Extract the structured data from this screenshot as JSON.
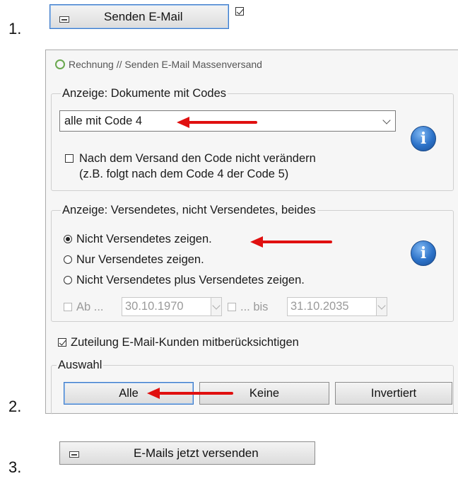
{
  "steps": {
    "one": "1.",
    "two": "2.",
    "three": "3."
  },
  "top_button": {
    "label": "Senden E-Mail",
    "icon": "envelope-icon"
  },
  "dialog": {
    "title": "Rechnung // Senden E-Mail Massenversand",
    "group_codes": {
      "legend": "Anzeige: Dokumente mit Codes",
      "combo_value": "alle mit Code 4",
      "checkbox_line1": "Nach dem Versand den Code nicht verändern",
      "checkbox_line2": "(z.B. folgt nach dem Code 4 der Code 5)"
    },
    "group_sent": {
      "legend": "Anzeige: Versendetes, nicht Versendetes, beides",
      "radio1": "Nicht Versendetes zeigen.",
      "radio2": "Nur Versendetes zeigen.",
      "radio3": "Nicht Versendetes plus Versendetes zeigen.",
      "from_label": "Ab ...",
      "from_date": "30.10.1970",
      "to_label": "... bis",
      "to_date": "31.10.2035"
    },
    "assign_checkbox": "Zuteilung E-Mail-Kunden mitberücksichtigen",
    "selection": {
      "legend": "Auswahl",
      "all": "Alle",
      "none": "Keine",
      "invert": "Invertiert"
    }
  },
  "send_button": {
    "label": "E-Mails jetzt versenden",
    "icon": "envelope-icon"
  },
  "info_icon_glyph": "i",
  "colors": {
    "arrow": "#e01010",
    "info": "#2c72c8",
    "focus": "#3a78c8"
  }
}
